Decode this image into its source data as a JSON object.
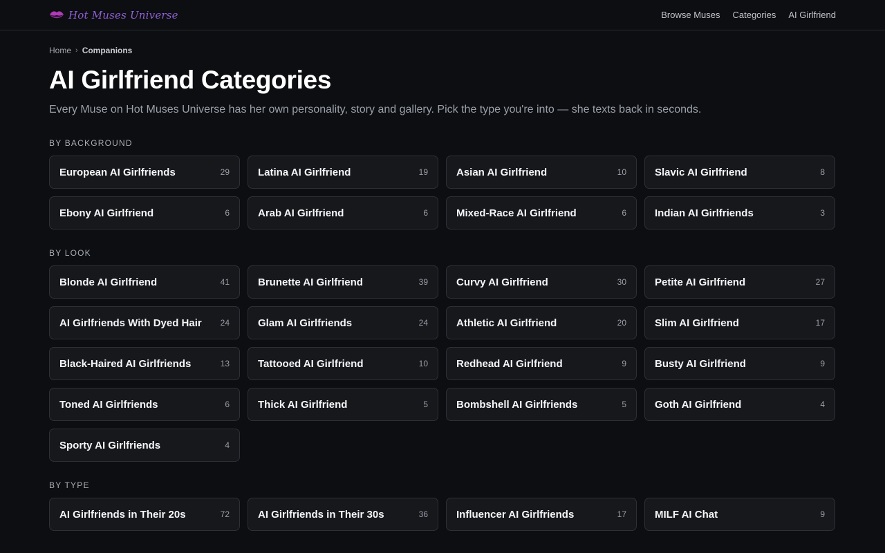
{
  "brand": {
    "logo_text": "Hot Muses Universe",
    "accent": "#b03ab8"
  },
  "nav": {
    "items": [
      "Browse Muses",
      "Categories",
      "AI Girlfriend"
    ]
  },
  "breadcrumb": {
    "home": "Home",
    "separator": "›",
    "current": "Companions"
  },
  "page": {
    "title": "AI Girlfriend Categories",
    "subtitle": "Every Muse on Hot Muses Universe has her own personality, story and gallery. Pick the type you're into — she texts back in seconds."
  },
  "sections": [
    {
      "label": "BY BACKGROUND",
      "items": [
        {
          "name": "European AI Girlfriends",
          "count": "29"
        },
        {
          "name": "Latina AI Girlfriend",
          "count": "19"
        },
        {
          "name": "Asian AI Girlfriend",
          "count": "10"
        },
        {
          "name": "Slavic AI Girlfriend",
          "count": "8"
        },
        {
          "name": "Ebony AI Girlfriend",
          "count": "6"
        },
        {
          "name": "Arab AI Girlfriend",
          "count": "6"
        },
        {
          "name": "Mixed-Race AI Girlfriend",
          "count": "6"
        },
        {
          "name": "Indian AI Girlfriends",
          "count": "3"
        }
      ]
    },
    {
      "label": "BY LOOK",
      "items": [
        {
          "name": "Blonde AI Girlfriend",
          "count": "41"
        },
        {
          "name": "Brunette AI Girlfriend",
          "count": "39"
        },
        {
          "name": "Curvy AI Girlfriend",
          "count": "30"
        },
        {
          "name": "Petite AI Girlfriend",
          "count": "27"
        },
        {
          "name": "AI Girlfriends With Dyed Hair",
          "count": "24"
        },
        {
          "name": "Glam AI Girlfriends",
          "count": "24"
        },
        {
          "name": "Athletic AI Girlfriend",
          "count": "20"
        },
        {
          "name": "Slim AI Girlfriend",
          "count": "17"
        },
        {
          "name": "Black-Haired AI Girlfriends",
          "count": "13"
        },
        {
          "name": "Tattooed AI Girlfriend",
          "count": "10"
        },
        {
          "name": "Redhead AI Girlfriend",
          "count": "9"
        },
        {
          "name": "Busty AI Girlfriend",
          "count": "9"
        },
        {
          "name": "Toned AI Girlfriends",
          "count": "6"
        },
        {
          "name": "Thick AI Girlfriend",
          "count": "5"
        },
        {
          "name": "Bombshell AI Girlfriends",
          "count": "5"
        },
        {
          "name": "Goth AI Girlfriend",
          "count": "4"
        },
        {
          "name": "Sporty AI Girlfriends",
          "count": "4"
        }
      ]
    },
    {
      "label": "BY TYPE",
      "items": [
        {
          "name": "AI Girlfriends in Their 20s",
          "count": "72"
        },
        {
          "name": "AI Girlfriends in Their 30s",
          "count": "36"
        },
        {
          "name": "Influencer AI Girlfriends",
          "count": "17"
        },
        {
          "name": "MILF AI Chat",
          "count": "9"
        }
      ]
    }
  ]
}
